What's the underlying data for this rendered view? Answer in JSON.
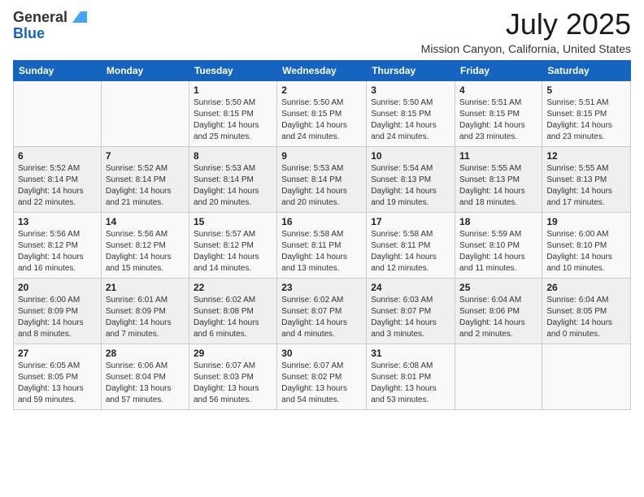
{
  "header": {
    "logo_general": "General",
    "logo_blue": "Blue",
    "title": "July 2025",
    "subtitle": "Mission Canyon, California, United States"
  },
  "days_of_week": [
    "Sunday",
    "Monday",
    "Tuesday",
    "Wednesday",
    "Thursday",
    "Friday",
    "Saturday"
  ],
  "weeks": [
    [
      {
        "day": "",
        "sunrise": "",
        "sunset": "",
        "daylight": ""
      },
      {
        "day": "",
        "sunrise": "",
        "sunset": "",
        "daylight": ""
      },
      {
        "day": "1",
        "sunrise": "Sunrise: 5:50 AM",
        "sunset": "Sunset: 8:15 PM",
        "daylight": "Daylight: 14 hours and 25 minutes."
      },
      {
        "day": "2",
        "sunrise": "Sunrise: 5:50 AM",
        "sunset": "Sunset: 8:15 PM",
        "daylight": "Daylight: 14 hours and 24 minutes."
      },
      {
        "day": "3",
        "sunrise": "Sunrise: 5:50 AM",
        "sunset": "Sunset: 8:15 PM",
        "daylight": "Daylight: 14 hours and 24 minutes."
      },
      {
        "day": "4",
        "sunrise": "Sunrise: 5:51 AM",
        "sunset": "Sunset: 8:15 PM",
        "daylight": "Daylight: 14 hours and 23 minutes."
      },
      {
        "day": "5",
        "sunrise": "Sunrise: 5:51 AM",
        "sunset": "Sunset: 8:15 PM",
        "daylight": "Daylight: 14 hours and 23 minutes."
      }
    ],
    [
      {
        "day": "6",
        "sunrise": "Sunrise: 5:52 AM",
        "sunset": "Sunset: 8:14 PM",
        "daylight": "Daylight: 14 hours and 22 minutes."
      },
      {
        "day": "7",
        "sunrise": "Sunrise: 5:52 AM",
        "sunset": "Sunset: 8:14 PM",
        "daylight": "Daylight: 14 hours and 21 minutes."
      },
      {
        "day": "8",
        "sunrise": "Sunrise: 5:53 AM",
        "sunset": "Sunset: 8:14 PM",
        "daylight": "Daylight: 14 hours and 20 minutes."
      },
      {
        "day": "9",
        "sunrise": "Sunrise: 5:53 AM",
        "sunset": "Sunset: 8:14 PM",
        "daylight": "Daylight: 14 hours and 20 minutes."
      },
      {
        "day": "10",
        "sunrise": "Sunrise: 5:54 AM",
        "sunset": "Sunset: 8:13 PM",
        "daylight": "Daylight: 14 hours and 19 minutes."
      },
      {
        "day": "11",
        "sunrise": "Sunrise: 5:55 AM",
        "sunset": "Sunset: 8:13 PM",
        "daylight": "Daylight: 14 hours and 18 minutes."
      },
      {
        "day": "12",
        "sunrise": "Sunrise: 5:55 AM",
        "sunset": "Sunset: 8:13 PM",
        "daylight": "Daylight: 14 hours and 17 minutes."
      }
    ],
    [
      {
        "day": "13",
        "sunrise": "Sunrise: 5:56 AM",
        "sunset": "Sunset: 8:12 PM",
        "daylight": "Daylight: 14 hours and 16 minutes."
      },
      {
        "day": "14",
        "sunrise": "Sunrise: 5:56 AM",
        "sunset": "Sunset: 8:12 PM",
        "daylight": "Daylight: 14 hours and 15 minutes."
      },
      {
        "day": "15",
        "sunrise": "Sunrise: 5:57 AM",
        "sunset": "Sunset: 8:12 PM",
        "daylight": "Daylight: 14 hours and 14 minutes."
      },
      {
        "day": "16",
        "sunrise": "Sunrise: 5:58 AM",
        "sunset": "Sunset: 8:11 PM",
        "daylight": "Daylight: 14 hours and 13 minutes."
      },
      {
        "day": "17",
        "sunrise": "Sunrise: 5:58 AM",
        "sunset": "Sunset: 8:11 PM",
        "daylight": "Daylight: 14 hours and 12 minutes."
      },
      {
        "day": "18",
        "sunrise": "Sunrise: 5:59 AM",
        "sunset": "Sunset: 8:10 PM",
        "daylight": "Daylight: 14 hours and 11 minutes."
      },
      {
        "day": "19",
        "sunrise": "Sunrise: 6:00 AM",
        "sunset": "Sunset: 8:10 PM",
        "daylight": "Daylight: 14 hours and 10 minutes."
      }
    ],
    [
      {
        "day": "20",
        "sunrise": "Sunrise: 6:00 AM",
        "sunset": "Sunset: 8:09 PM",
        "daylight": "Daylight: 14 hours and 8 minutes."
      },
      {
        "day": "21",
        "sunrise": "Sunrise: 6:01 AM",
        "sunset": "Sunset: 8:09 PM",
        "daylight": "Daylight: 14 hours and 7 minutes."
      },
      {
        "day": "22",
        "sunrise": "Sunrise: 6:02 AM",
        "sunset": "Sunset: 8:08 PM",
        "daylight": "Daylight: 14 hours and 6 minutes."
      },
      {
        "day": "23",
        "sunrise": "Sunrise: 6:02 AM",
        "sunset": "Sunset: 8:07 PM",
        "daylight": "Daylight: 14 hours and 4 minutes."
      },
      {
        "day": "24",
        "sunrise": "Sunrise: 6:03 AM",
        "sunset": "Sunset: 8:07 PM",
        "daylight": "Daylight: 14 hours and 3 minutes."
      },
      {
        "day": "25",
        "sunrise": "Sunrise: 6:04 AM",
        "sunset": "Sunset: 8:06 PM",
        "daylight": "Daylight: 14 hours and 2 minutes."
      },
      {
        "day": "26",
        "sunrise": "Sunrise: 6:04 AM",
        "sunset": "Sunset: 8:05 PM",
        "daylight": "Daylight: 14 hours and 0 minutes."
      }
    ],
    [
      {
        "day": "27",
        "sunrise": "Sunrise: 6:05 AM",
        "sunset": "Sunset: 8:05 PM",
        "daylight": "Daylight: 13 hours and 59 minutes."
      },
      {
        "day": "28",
        "sunrise": "Sunrise: 6:06 AM",
        "sunset": "Sunset: 8:04 PM",
        "daylight": "Daylight: 13 hours and 57 minutes."
      },
      {
        "day": "29",
        "sunrise": "Sunrise: 6:07 AM",
        "sunset": "Sunset: 8:03 PM",
        "daylight": "Daylight: 13 hours and 56 minutes."
      },
      {
        "day": "30",
        "sunrise": "Sunrise: 6:07 AM",
        "sunset": "Sunset: 8:02 PM",
        "daylight": "Daylight: 13 hours and 54 minutes."
      },
      {
        "day": "31",
        "sunrise": "Sunrise: 6:08 AM",
        "sunset": "Sunset: 8:01 PM",
        "daylight": "Daylight: 13 hours and 53 minutes."
      },
      {
        "day": "",
        "sunrise": "",
        "sunset": "",
        "daylight": ""
      },
      {
        "day": "",
        "sunrise": "",
        "sunset": "",
        "daylight": ""
      }
    ]
  ]
}
